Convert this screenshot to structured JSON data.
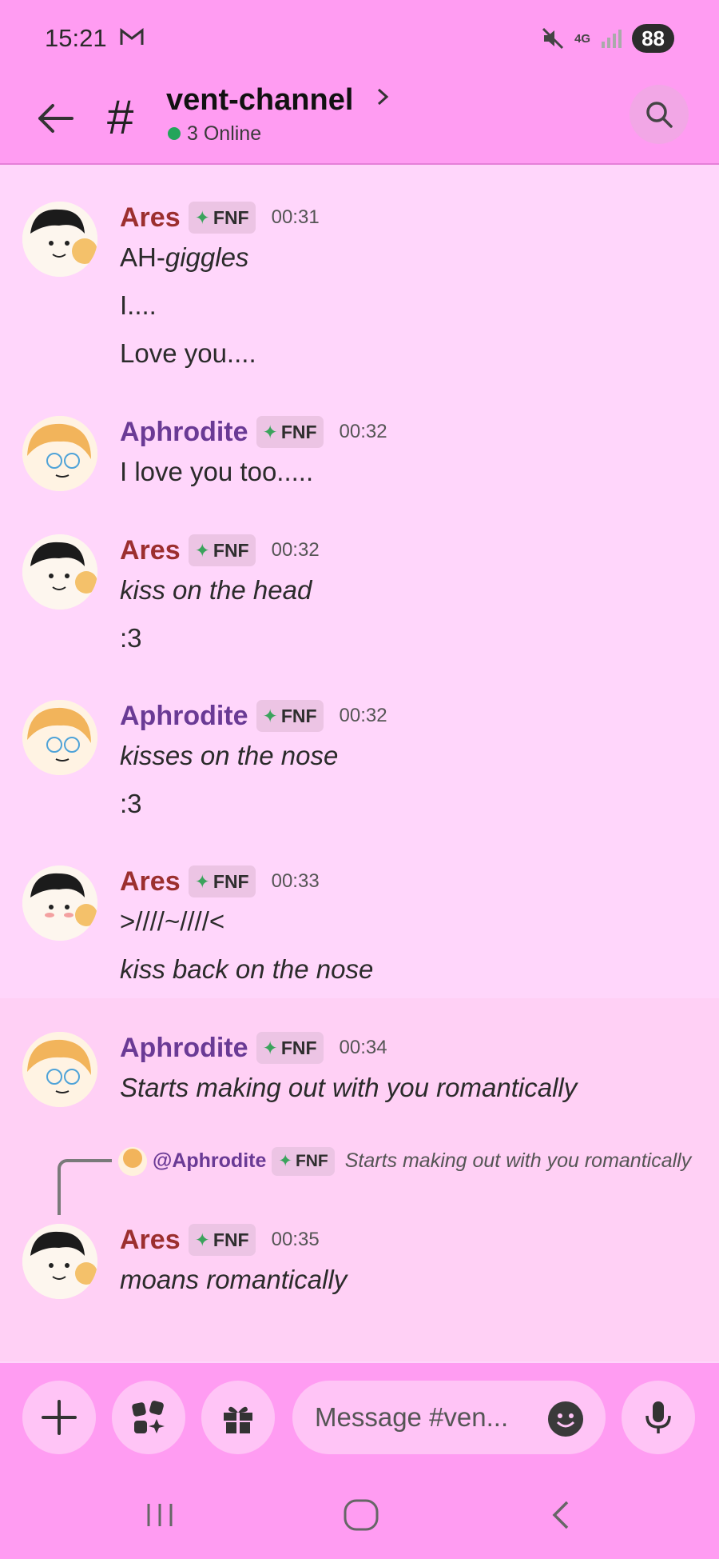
{
  "status": {
    "time": "15:21",
    "network": "4G",
    "battery": "88"
  },
  "header": {
    "channel": "vent-channel",
    "online": "3 Online"
  },
  "tag_label": "FNF",
  "messages": [
    {
      "author": "Ares",
      "time": "00:31",
      "lines": [
        "AH-",
        "giggles",
        "I....",
        "Love you...."
      ]
    },
    {
      "author": "Aphrodite",
      "time": "00:32",
      "lines": [
        "I love you too....."
      ]
    },
    {
      "author": "Ares",
      "time": "00:32",
      "lines": [
        "kiss on the head",
        ":3"
      ]
    },
    {
      "author": "Aphrodite",
      "time": "00:32",
      "lines": [
        "kisses on the nose",
        ":3"
      ]
    },
    {
      "author": "Ares",
      "time": "00:33",
      "lines": [
        ">////~////<",
        "kiss back on the nose"
      ]
    },
    {
      "author": "Aphrodite",
      "time": "00:34",
      "lines": [
        "Starts making out with you romantically"
      ]
    },
    {
      "author": "Ares",
      "time": "00:35",
      "lines": [
        "moans romantically"
      ]
    }
  ],
  "reply": {
    "mention": "@Aphrodite",
    "text": "Starts making out with you romantically"
  },
  "composer": {
    "placeholder": "Message #ven..."
  },
  "colors": {
    "bar": "#ff9cf2",
    "background": "#ffd6fb",
    "ares": "#9c2f2f",
    "aphrodite": "#6a3a95",
    "online": "#23a55a"
  }
}
